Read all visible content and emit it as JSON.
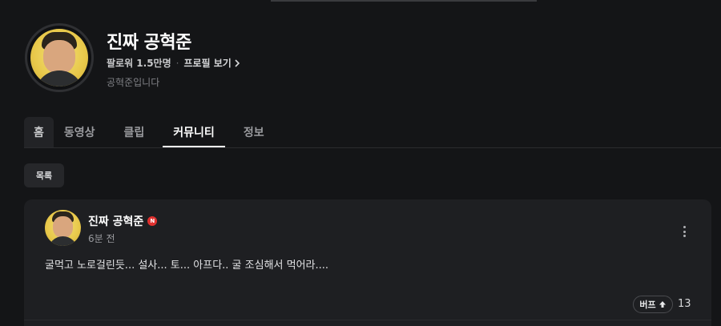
{
  "channel": {
    "name": "진짜 공혁준",
    "followers": "팔로워 1.5만명",
    "profile_link": "프로필 보기",
    "description": "공혁준입니다"
  },
  "tabs": [
    {
      "label": "홈",
      "state": "hover"
    },
    {
      "label": "동영상"
    },
    {
      "label": "클립"
    },
    {
      "label": "커뮤니티",
      "state": "active"
    },
    {
      "label": "정보"
    }
  ],
  "list_button": "목록",
  "post": {
    "author": "진짜 공혁준",
    "badge": "N",
    "time": "6분 전",
    "content": "굴먹고 노로걸린듯... 설사... 토... 아프다.. 굴 조심해서 먹어라....",
    "buff_label": "버프",
    "buff_count": "13"
  },
  "icons": {
    "verified": "partner-badge-icon",
    "more": "more-vertical-icon",
    "buff": "arrow-up-icon",
    "chevron": "chevron-right-icon"
  },
  "colors": {
    "background": "#141517",
    "card": "#1e1f22",
    "badge": "#e0312f"
  }
}
